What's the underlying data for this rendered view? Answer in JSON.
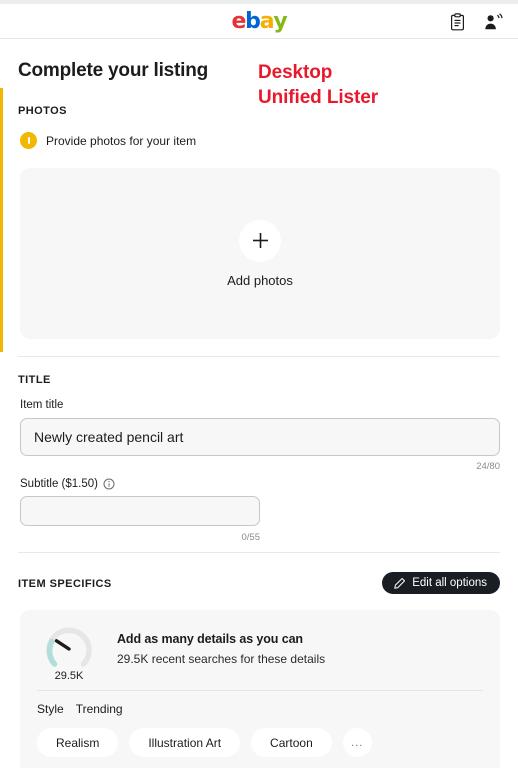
{
  "header": {
    "logo": {
      "e": "e",
      "b": "b",
      "a": "a",
      "y": "y"
    },
    "icons": [
      {
        "name": "clipboard-icon",
        "label": "Listings clipboard"
      },
      {
        "name": "seller-announcement-icon",
        "label": "Seller notifications"
      }
    ]
  },
  "page": {
    "title": "Complete your listing",
    "annotation_line1": "Desktop",
    "annotation_line2": "Unified Lister",
    "accent_color": "#f2b700"
  },
  "photos": {
    "section_label": "PHOTOS",
    "warning_text": "Provide photos for your item",
    "dropzone_label": "Add photos",
    "dropzone_icon": "plus-icon"
  },
  "title_section": {
    "section_label": "TITLE",
    "item_title_label": "Item title",
    "item_title_value": "Newly created pencil art",
    "item_title_placeholder": "",
    "item_title_counter": "24/80",
    "subtitle_label": "Subtitle ($1.50)",
    "subtitle_info_icon": "info-icon",
    "subtitle_value": "",
    "subtitle_placeholder": "",
    "subtitle_counter": "0/55"
  },
  "item_specifics": {
    "section_label": "ITEM SPECIFICS",
    "edit_button_label": "Edit all options",
    "edit_button_icon": "pencil-icon",
    "edit_button_color": "#191e25",
    "gauge": {
      "value_label": "29.5K",
      "arc_color": "#b2ddd8",
      "track_color": "#e6e6e6",
      "needle_color": "#1c1c1c",
      "fill_fraction": 0.22
    },
    "headline": "Add as many details as you can",
    "subtext": "29.5K recent searches for these details",
    "aspect_name": "Style",
    "aspect_trend": "Trending",
    "chips": [
      "Realism",
      "Illustration Art",
      "Cartoon",
      "..."
    ]
  }
}
